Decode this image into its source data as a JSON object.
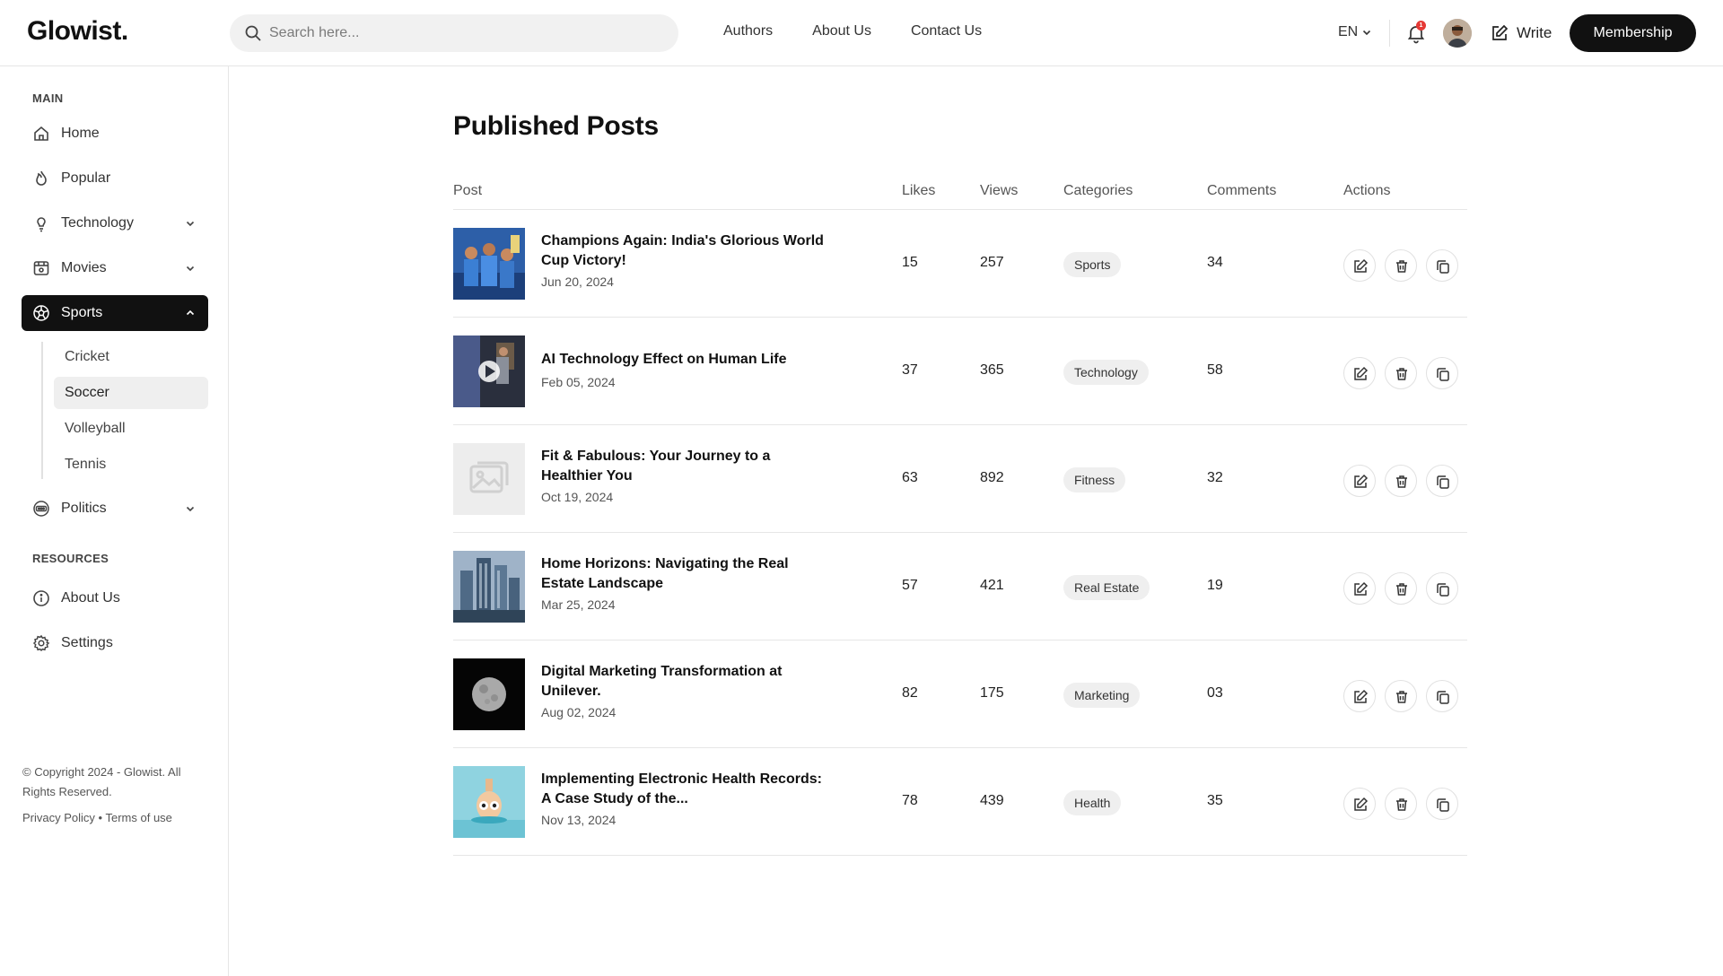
{
  "brand": {
    "logo": "Glowist."
  },
  "header": {
    "search_placeholder": "Search here...",
    "nav": [
      "Authors",
      "About Us",
      "Contact Us"
    ],
    "language": "EN",
    "notification_count": "1",
    "write_label": "Write",
    "membership_label": "Membership"
  },
  "sidebar": {
    "main_title": "MAIN",
    "items": [
      {
        "label": "Home",
        "icon": "home-icon"
      },
      {
        "label": "Popular",
        "icon": "flame-icon"
      },
      {
        "label": "Technology",
        "icon": "lightbulb-icon",
        "expandable": true
      },
      {
        "label": "Movies",
        "icon": "film-icon",
        "expandable": true
      },
      {
        "label": "Sports",
        "icon": "soccer-ball-icon",
        "expandable": true,
        "active": true
      }
    ],
    "sports_sub": [
      "Cricket",
      "Soccer",
      "Volleyball",
      "Tennis"
    ],
    "sports_selected": "Soccer",
    "politics": {
      "label": "Politics",
      "icon": "politics-icon"
    },
    "resources_title": "RESOURCES",
    "resources": [
      {
        "label": "About Us",
        "icon": "info-icon"
      },
      {
        "label": "Settings",
        "icon": "gear-icon"
      }
    ],
    "copyright": "© Copyright 2024 - Glowist. All Rights Reserved.",
    "privacy": "Privacy Policy",
    "separator": "•",
    "terms": "Terms of use"
  },
  "main": {
    "title": "Published Posts",
    "columns": [
      "Post",
      "Likes",
      "Views",
      "Categories",
      "Comments",
      "Actions"
    ],
    "posts": [
      {
        "title": "Champions Again: India's Glorious World Cup Victory!",
        "date": "Jun 20, 2024",
        "likes": "15",
        "views": "257",
        "category": "Sports",
        "comments": "34"
      },
      {
        "title": "AI Technology Effect on Human Life",
        "date": "Feb 05, 2024",
        "likes": "37",
        "views": "365",
        "category": "Technology",
        "comments": "58"
      },
      {
        "title": "Fit & Fabulous: Your Journey to a Healthier You",
        "date": "Oct 19, 2024",
        "likes": "63",
        "views": "892",
        "category": "Fitness",
        "comments": "32"
      },
      {
        "title": "Home Horizons: Navigating the Real Estate Landscape",
        "date": "Mar 25, 2024",
        "likes": "57",
        "views": "421",
        "category": "Real Estate",
        "comments": "19"
      },
      {
        "title": "Digital Marketing Transformation at Unilever.",
        "date": "Aug 02, 2024",
        "likes": "82",
        "views": "175",
        "category": "Marketing",
        "comments": "03"
      },
      {
        "title": "Implementing Electronic Health Records: A Case Study of the...",
        "date": "Nov 13, 2024",
        "likes": "78",
        "views": "439",
        "category": "Health",
        "comments": "35"
      }
    ]
  },
  "colors": {
    "accent": "#111111",
    "chip_bg": "#efefef",
    "border": "#e6e6e6",
    "notification": "#e53935"
  }
}
